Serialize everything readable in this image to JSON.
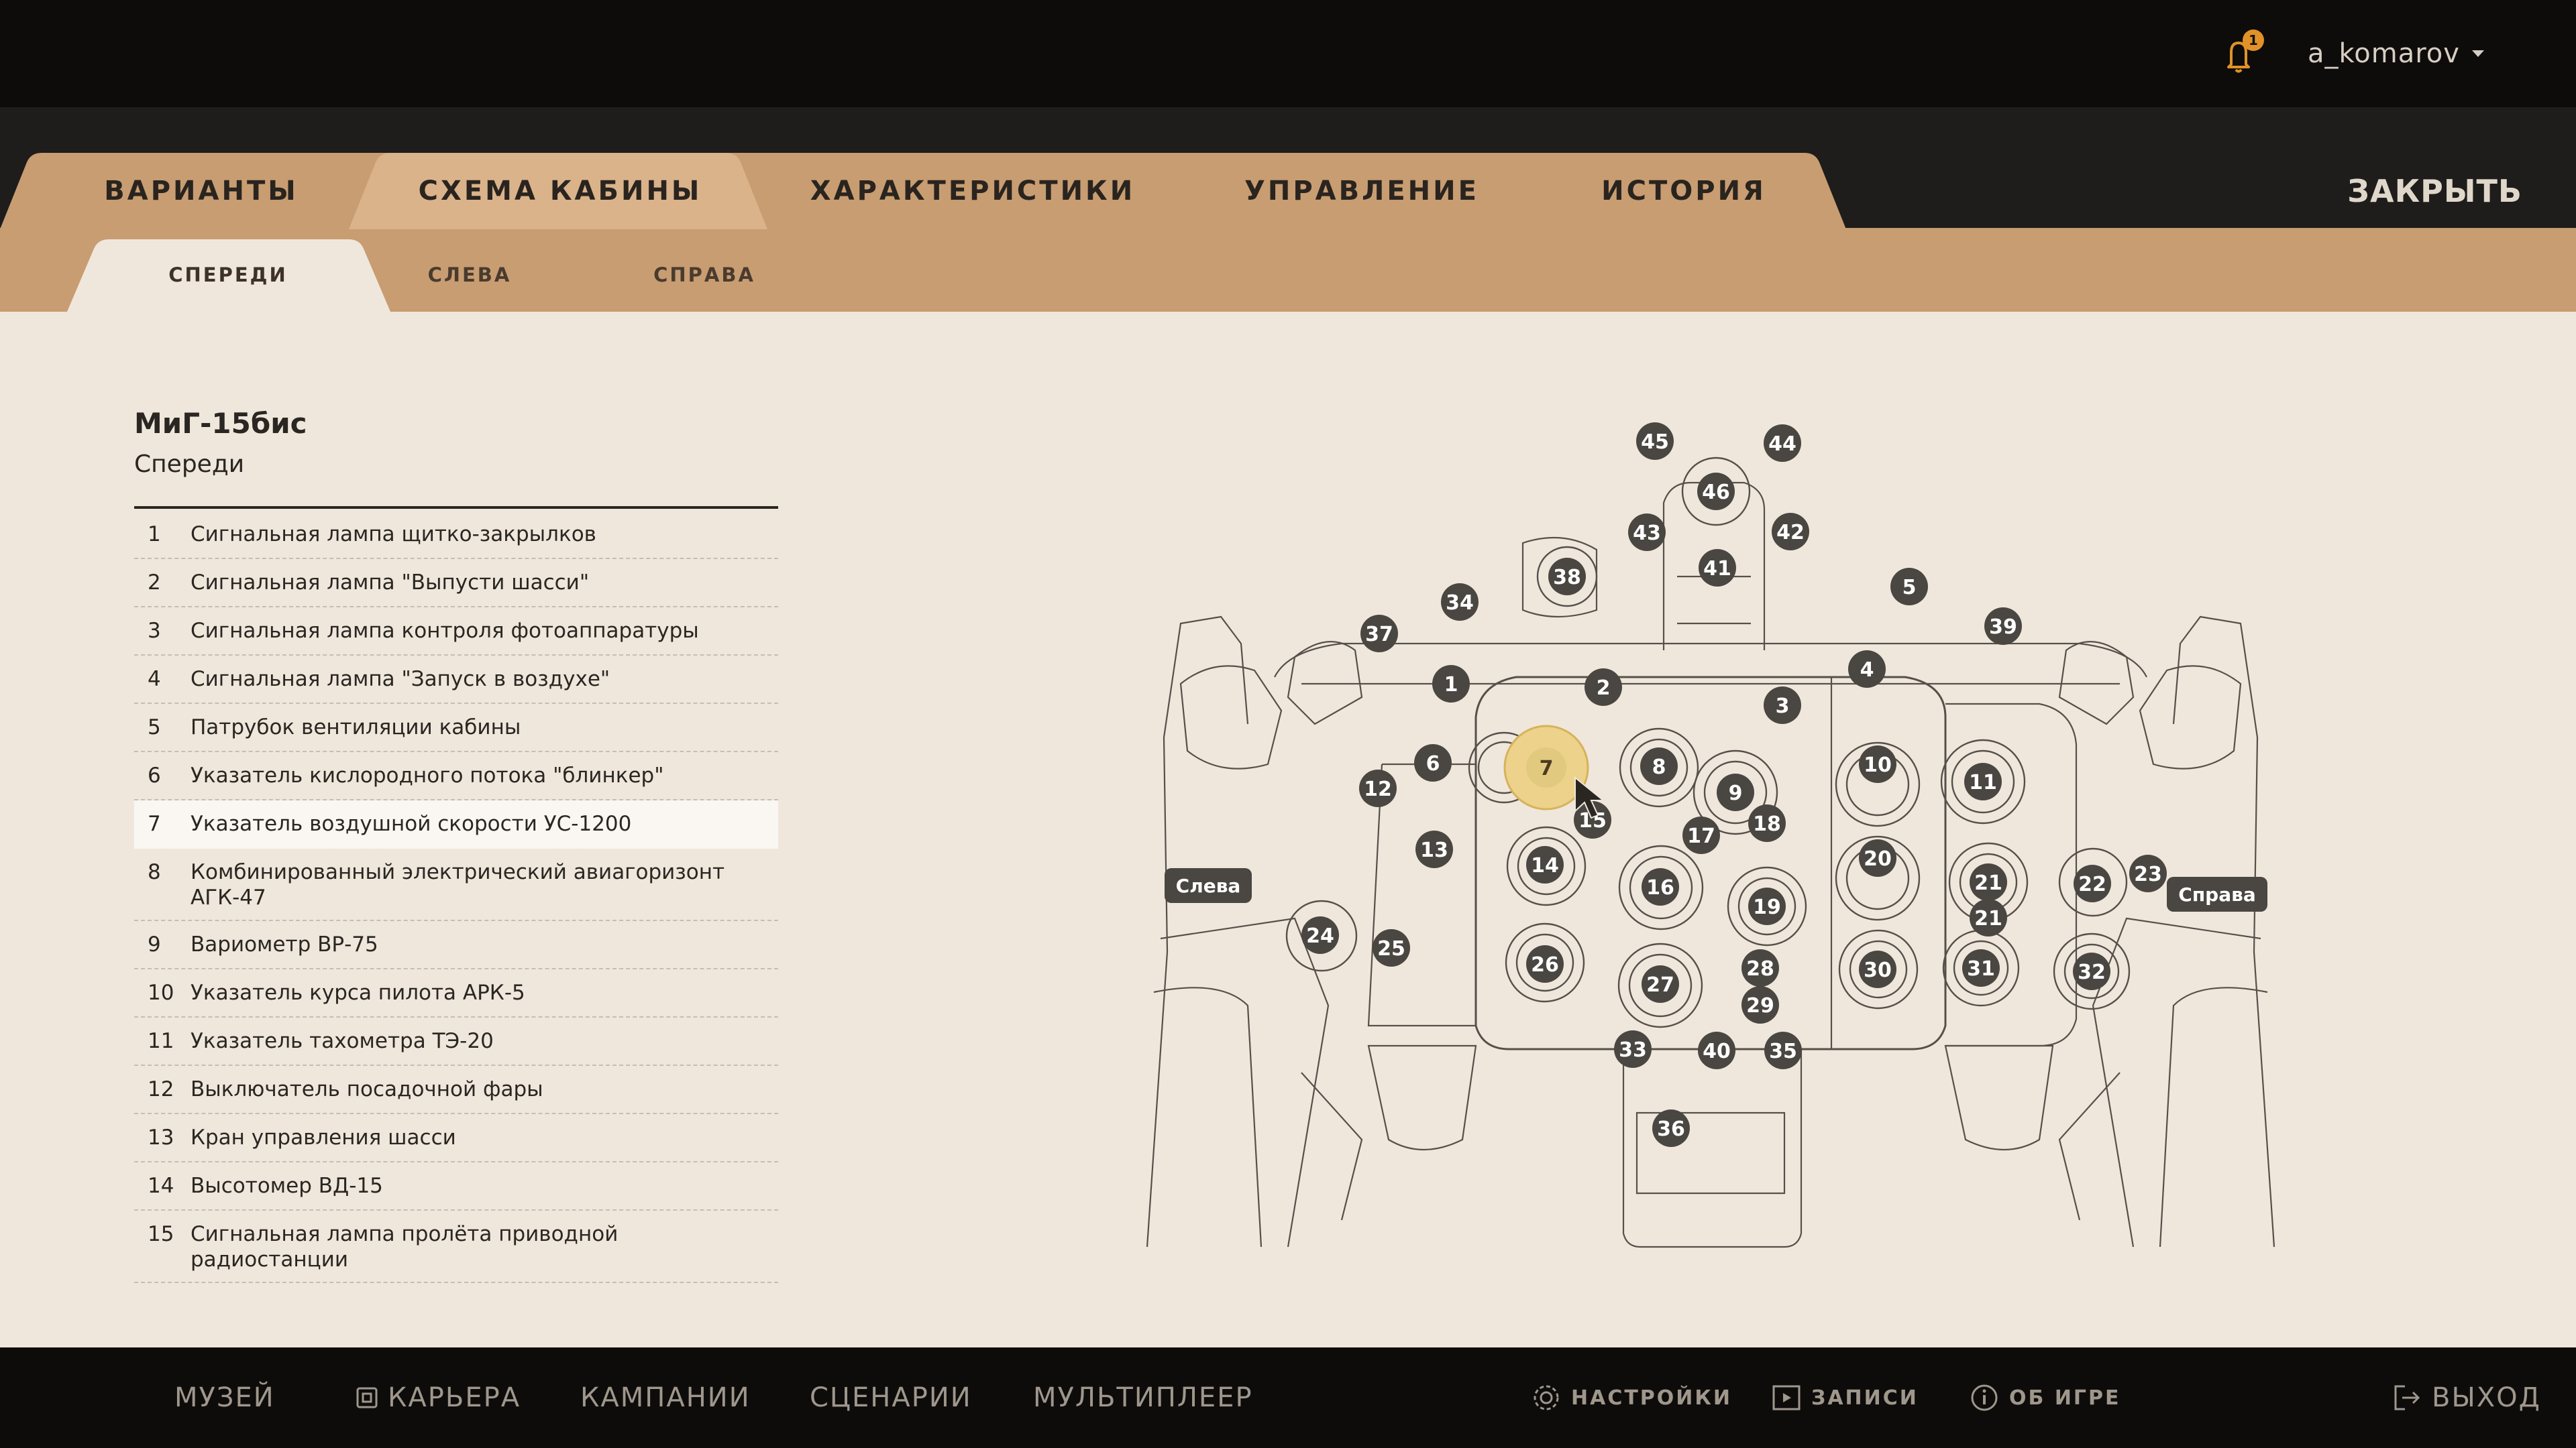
{
  "user": {
    "name": "a_komarov",
    "notifications": "1"
  },
  "tabs": [
    "ВАРИАНТЫ",
    "СХЕМА КАБИНЫ",
    "ХАРАКТЕРИСТИКИ",
    "УПРАВЛЕНИЕ",
    "ИСТОРИЯ"
  ],
  "active_tab": "СХЕМА КАБИНЫ",
  "close_label": "ЗАКРЫТЬ",
  "subtabs": [
    "СПЕРЕДИ",
    "СЛЕВА",
    "СПРАВА"
  ],
  "active_subtab": "СПЕРЕДИ",
  "aircraft": {
    "title": "МиГ-15бис",
    "view": "Спереди"
  },
  "parts": [
    {
      "num": "1",
      "text": "Сигнальная лампа щитко-закрылков"
    },
    {
      "num": "2",
      "text": "Сигнальная лампа \"Выпусти шасси\""
    },
    {
      "num": "3",
      "text": "Сигнальная лампа контроля фотоаппаратуры"
    },
    {
      "num": "4",
      "text": "Сигнальная лампа \"Запуск в воздухе\""
    },
    {
      "num": "5",
      "text": "Патрубок вентиляции кабины"
    },
    {
      "num": "6",
      "text": "Указатель кислородного потока \"блинкер\""
    },
    {
      "num": "7",
      "text": "Указатель воздушной скорости УС-1200"
    },
    {
      "num": "8",
      "text": "Комбинированный электрический авиагоризонт АГК-47"
    },
    {
      "num": "9",
      "text": "Вариометр ВР-75"
    },
    {
      "num": "10",
      "text": "Указатель курса пилота АРК-5"
    },
    {
      "num": "11",
      "text": "Указатель тахометра ТЭ-20"
    },
    {
      "num": "12",
      "text": "Выключатель посадочной фары"
    },
    {
      "num": "13",
      "text": "Кран управления шасси"
    },
    {
      "num": "14",
      "text": "Высотомер ВД-15"
    },
    {
      "num": "15",
      "text": "Сигнальная лампа пролёта приводной радиостанции"
    }
  ],
  "selected_part": "7",
  "cockpit": {
    "left_label": "Слева",
    "right_label": "Справа",
    "markers": [
      "1",
      "2",
      "3",
      "4",
      "5",
      "6",
      "7",
      "8",
      "9",
      "10",
      "11",
      "12",
      "13",
      "14",
      "15",
      "16",
      "17",
      "18",
      "19",
      "20",
      "21",
      "21",
      "22",
      "23",
      "24",
      "25",
      "26",
      "27",
      "28",
      "29",
      "30",
      "31",
      "32",
      "33",
      "34",
      "35",
      "36",
      "37",
      "38",
      "39",
      "40",
      "41",
      "42",
      "43",
      "44",
      "45",
      "46"
    ]
  },
  "bottom_nav": [
    "МУЗЕЙ",
    "КАРЬЕРА",
    "КАМПАНИИ",
    "СЦЕНАРИИ",
    "МУЛЬТИПЛЕЕР"
  ],
  "bottom_right": [
    "НАСТРОЙКИ",
    "ЗАПИСИ",
    "ОБ ИГРЕ",
    "ВЫХОД"
  ],
  "colors": {
    "tab_bg": "#c89d72",
    "active_tab": "#efe7dc",
    "highlight": "#ecd28a",
    "marker": "#4a4641"
  }
}
